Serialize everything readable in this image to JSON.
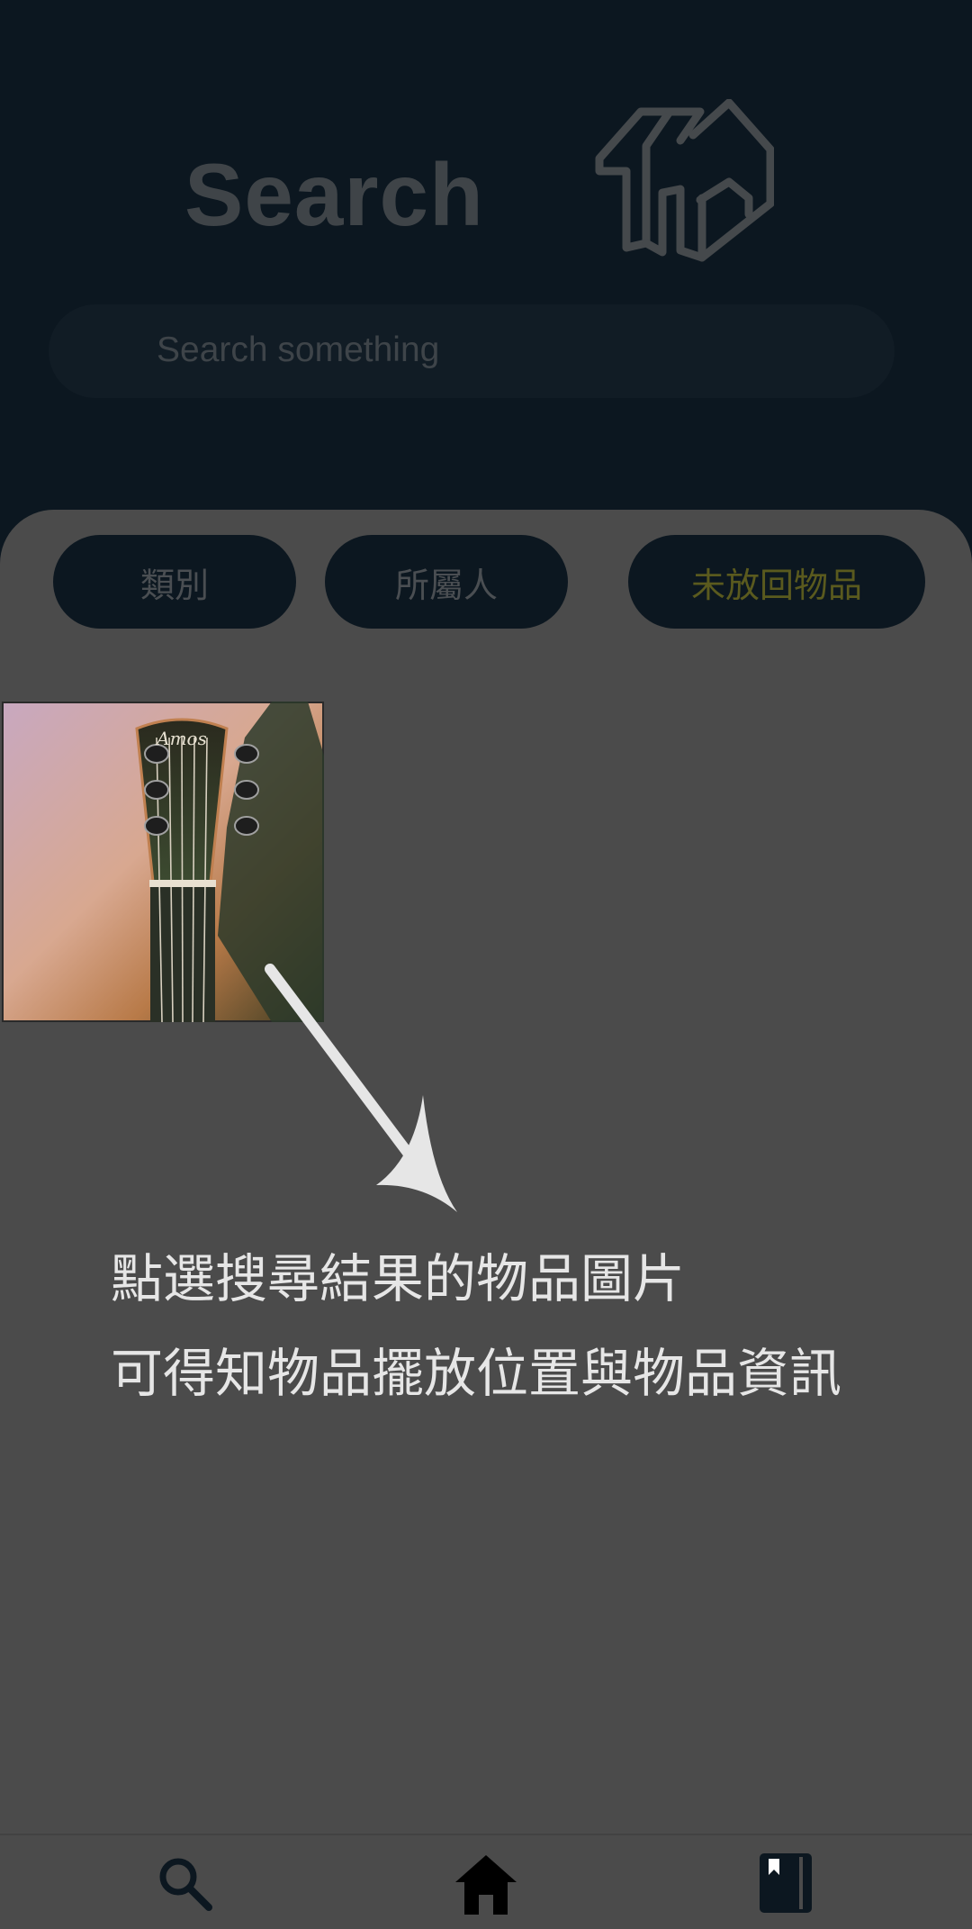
{
  "header": {
    "title": "Search",
    "logo_icon": "house-logo-icon"
  },
  "search": {
    "placeholder": "Search something"
  },
  "filters": [
    {
      "label": "類別",
      "color": "#4a4e52"
    },
    {
      "label": "所屬人",
      "color": "#4a4e52"
    },
    {
      "label": "未放回物品",
      "color": "#5a5a1e"
    }
  ],
  "results": [
    {
      "image": "guitar-headstock-photo",
      "brand_text": "Amos"
    }
  ],
  "hint": {
    "line1": "點選搜尋結果的物品圖片",
    "line2": "可得知物品擺放位置與物品資訊"
  },
  "bottom_nav": [
    {
      "icon": "search-icon"
    },
    {
      "icon": "home-icon"
    },
    {
      "icon": "book-icon"
    }
  ],
  "colors": {
    "background": "#0c1720",
    "overlay": "#4b4b4b",
    "hint_text": "#e6e6e6"
  }
}
